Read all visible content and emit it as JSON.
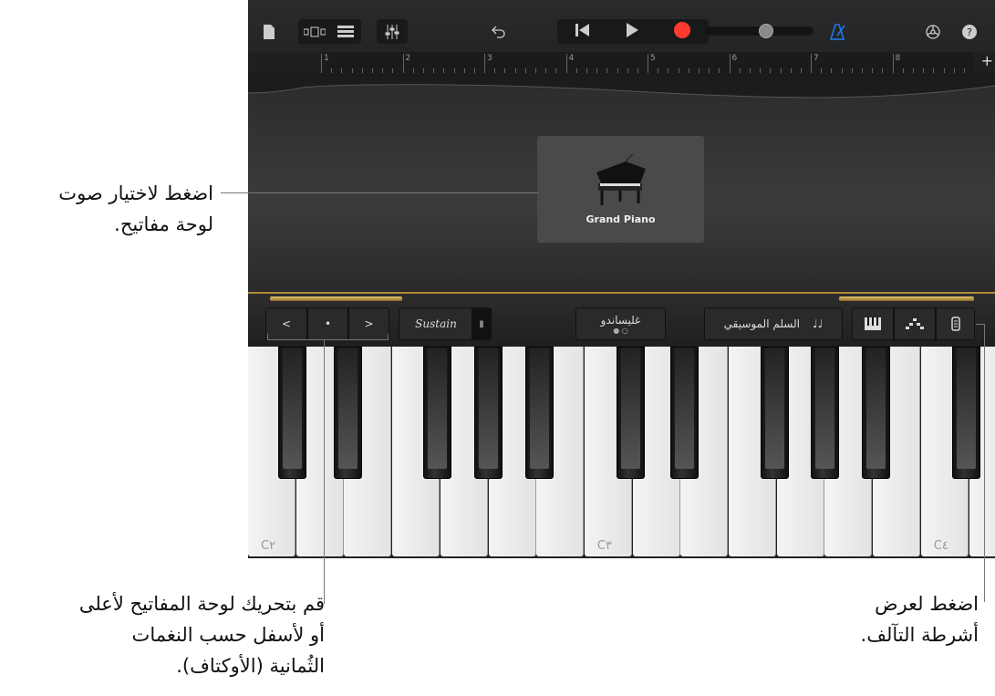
{
  "toolbar": {
    "icons": [
      "document-icon",
      "browser-view-icon",
      "tracks-view-icon",
      "mixer-icon",
      "undo-icon",
      "go-to-start-icon",
      "play-icon",
      "record-icon",
      "master-volume-slider",
      "metronome-icon",
      "settings-icon",
      "help-icon"
    ],
    "volume_level": 0.6,
    "record_color": "#ff3b30",
    "metronome_color": "#1e7cf2"
  },
  "ruler": {
    "bars": [
      "1",
      "2",
      "3",
      "4",
      "5",
      "6",
      "7",
      "8"
    ],
    "add_label": "+"
  },
  "instrument": {
    "name": "Grand Piano"
  },
  "controls": {
    "octave_down": "<",
    "octave_reset": "•",
    "octave_up": ">",
    "sustain": "Sustain",
    "glissando": "غليساندو",
    "scale": "السلم الموسيقي",
    "scale_icon": "♩♩"
  },
  "keys": {
    "labels": {
      "c2": "C٢",
      "c3": "C٣",
      "c4": "C٤"
    }
  },
  "callouts": {
    "choose_sound": [
      "اضغط لاختيار صوت",
      "لوحة مفاتيح."
    ],
    "move_octave": [
      "قم بتحريك لوحة المفاتيح لأعلى",
      "أو لأسفل حسب النغمات",
      "الثُمانية (الأوكتاف)."
    ],
    "chord_strips": [
      "اضغط لعرض",
      "أشرطة التآلف."
    ]
  }
}
